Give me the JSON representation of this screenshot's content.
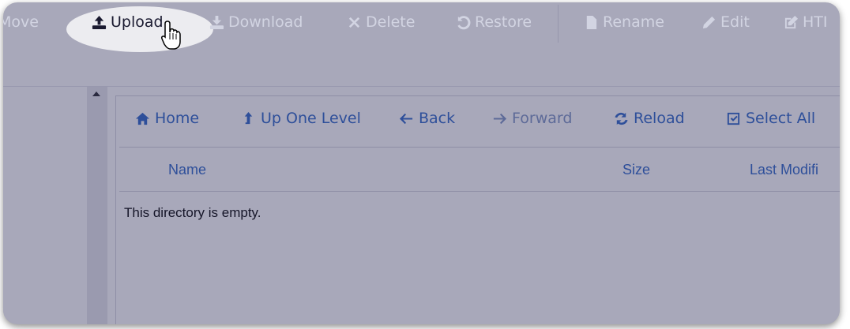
{
  "toolbar": {
    "move": "Move",
    "upload": "Upload",
    "download": "Download",
    "delete": "Delete",
    "restore": "Restore",
    "rename": "Rename",
    "edit": "Edit",
    "html": "HTI"
  },
  "nav": {
    "home": "Home",
    "up": "Up One Level",
    "back": "Back",
    "forward": "Forward",
    "reload": "Reload",
    "select_all": "Select All"
  },
  "table": {
    "col_name": "Name",
    "col_size": "Size",
    "col_modified": "Last Modifi"
  },
  "empty_message": "This directory is empty.",
  "icons": [
    "upload-icon",
    "download-icon",
    "delete-icon",
    "restore-icon",
    "file-icon",
    "pencil-icon",
    "edit-square-icon",
    "home-icon",
    "up-level-icon",
    "arrow-left-icon",
    "arrow-right-icon",
    "reload-icon",
    "checkbox-icon",
    "hand-cursor-icon"
  ],
  "colors": {
    "frame": "#a8a8ba",
    "link": "#2e4f9a",
    "highlight": "#ececf0"
  }
}
